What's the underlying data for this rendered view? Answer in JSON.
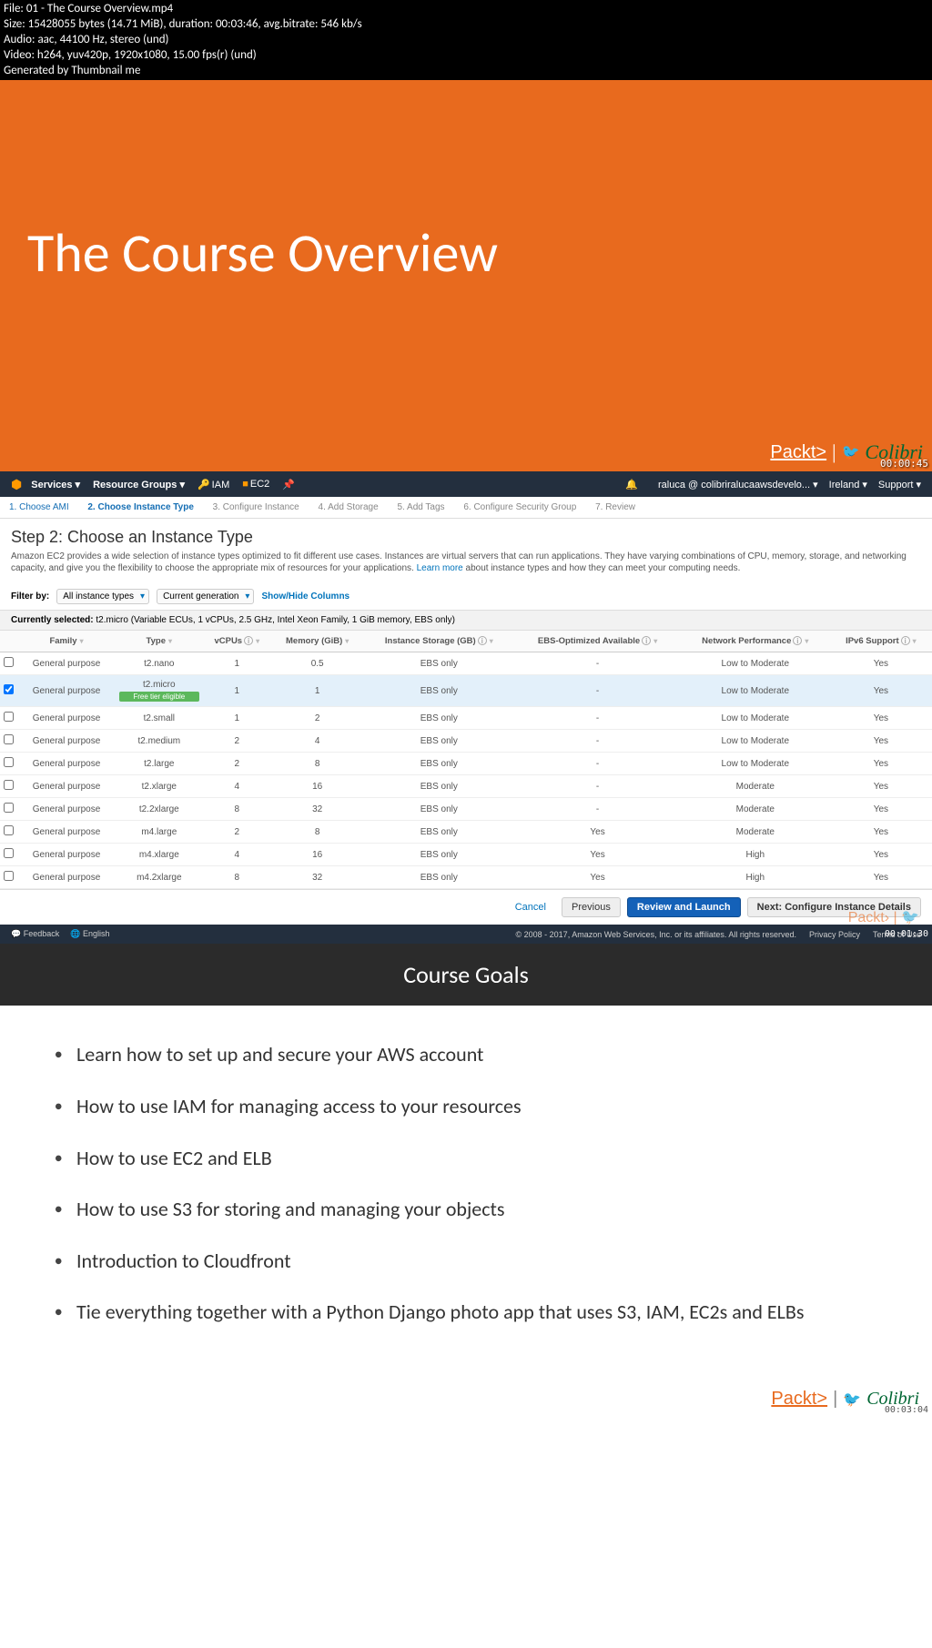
{
  "meta": {
    "line1": "File: 01 - The Course Overview.mp4",
    "line2": "Size: 15428055 bytes (14.71 MiB), duration: 00:03:46, avg.bitrate: 546 kb/s",
    "line3": "Audio: aac, 44100 Hz, stereo (und)",
    "line4": "Video: h264, yuv420p, 1920x1080, 15.00 fps(r) (und)",
    "line5": "Generated by Thumbnail me"
  },
  "slide1": {
    "title": "The Course Overview",
    "brand_packt": "Packt>",
    "brand_colibri": "Colibri",
    "timestamp": "00:00:45"
  },
  "aws": {
    "nav": {
      "services": "Services",
      "resource_groups": "Resource Groups",
      "iam": "IAM",
      "ec2": "EC2",
      "user": "raluca @ colibriralucaawsdevelo...",
      "region": "Ireland",
      "support": "Support"
    },
    "steps": {
      "s1": "1. Choose AMI",
      "s2": "2. Choose Instance Type",
      "s3": "3. Configure Instance",
      "s4": "4. Add Storage",
      "s5": "5. Add Tags",
      "s6": "6. Configure Security Group",
      "s7": "7. Review"
    },
    "heading": "Step 2: Choose an Instance Type",
    "description": "Amazon EC2 provides a wide selection of instance types optimized to fit different use cases. Instances are virtual servers that can run applications. They have varying combinations of CPU, memory, storage, and networking capacity, and give you the flexibility to choose the appropriate mix of resources for your applications. ",
    "learn_more": "Learn more",
    "description2": " about instance types and how they can meet your computing needs.",
    "filter": {
      "label": "Filter by:",
      "all": "All instance types",
      "gen": "Current generation",
      "show_hide": "Show/Hide Columns"
    },
    "selected_label": "Currently selected:",
    "selected_desc": " t2.micro (Variable ECUs, 1 vCPUs, 2.5 GHz, Intel Xeon Family, 1 GiB memory, EBS only)",
    "headers": {
      "family": "Family",
      "type": "Type",
      "vcpus": "vCPUs",
      "memory": "Memory (GiB)",
      "storage": "Instance Storage (GB)",
      "ebs": "EBS-Optimized Available",
      "network": "Network Performance",
      "ipv6": "IPv6 Support"
    },
    "rows": [
      {
        "family": "General purpose",
        "type": "t2.nano",
        "free": "",
        "vcpus": "1",
        "memory": "0.5",
        "storage": "EBS only",
        "ebs": "-",
        "network": "Low to Moderate",
        "ipv6": "Yes",
        "selected": false
      },
      {
        "family": "General purpose",
        "type": "t2.micro",
        "free": "Free tier eligible",
        "vcpus": "1",
        "memory": "1",
        "storage": "EBS only",
        "ebs": "-",
        "network": "Low to Moderate",
        "ipv6": "Yes",
        "selected": true
      },
      {
        "family": "General purpose",
        "type": "t2.small",
        "free": "",
        "vcpus": "1",
        "memory": "2",
        "storage": "EBS only",
        "ebs": "-",
        "network": "Low to Moderate",
        "ipv6": "Yes",
        "selected": false
      },
      {
        "family": "General purpose",
        "type": "t2.medium",
        "free": "",
        "vcpus": "2",
        "memory": "4",
        "storage": "EBS only",
        "ebs": "-",
        "network": "Low to Moderate",
        "ipv6": "Yes",
        "selected": false
      },
      {
        "family": "General purpose",
        "type": "t2.large",
        "free": "",
        "vcpus": "2",
        "memory": "8",
        "storage": "EBS only",
        "ebs": "-",
        "network": "Low to Moderate",
        "ipv6": "Yes",
        "selected": false
      },
      {
        "family": "General purpose",
        "type": "t2.xlarge",
        "free": "",
        "vcpus": "4",
        "memory": "16",
        "storage": "EBS only",
        "ebs": "-",
        "network": "Moderate",
        "ipv6": "Yes",
        "selected": false
      },
      {
        "family": "General purpose",
        "type": "t2.2xlarge",
        "free": "",
        "vcpus": "8",
        "memory": "32",
        "storage": "EBS only",
        "ebs": "-",
        "network": "Moderate",
        "ipv6": "Yes",
        "selected": false
      },
      {
        "family": "General purpose",
        "type": "m4.large",
        "free": "",
        "vcpus": "2",
        "memory": "8",
        "storage": "EBS only",
        "ebs": "Yes",
        "network": "Moderate",
        "ipv6": "Yes",
        "selected": false
      },
      {
        "family": "General purpose",
        "type": "m4.xlarge",
        "free": "",
        "vcpus": "4",
        "memory": "16",
        "storage": "EBS only",
        "ebs": "Yes",
        "network": "High",
        "ipv6": "Yes",
        "selected": false
      },
      {
        "family": "General purpose",
        "type": "m4.2xlarge",
        "free": "",
        "vcpus": "8",
        "memory": "32",
        "storage": "EBS only",
        "ebs": "Yes",
        "network": "High",
        "ipv6": "Yes",
        "selected": false
      }
    ],
    "actions": {
      "cancel": "Cancel",
      "previous": "Previous",
      "review": "Review and Launch",
      "next": "Next: Configure Instance Details"
    },
    "footer": {
      "feedback": "Feedback",
      "english": "English",
      "copyright": "© 2008 - 2017, Amazon Web Services, Inc. or its affiliates. All rights reserved.",
      "privacy": "Privacy Policy",
      "terms": "Terms of Use",
      "timestamp": "00:01:30"
    }
  },
  "goals": {
    "title": "Course Goals",
    "items": [
      "Learn how to set up and secure your AWS account",
      "How to use IAM for managing access to your resources",
      "How to use EC2 and ELB",
      "How to use S3 for storing and managing your objects",
      "Introduction to Cloudfront",
      "Tie everything together with a Python Django photo app that uses S3, IAM, EC2s and ELBs"
    ],
    "brand_packt": "Packt>",
    "brand_colibri": "Colibri",
    "timestamp": "00:03:04"
  }
}
